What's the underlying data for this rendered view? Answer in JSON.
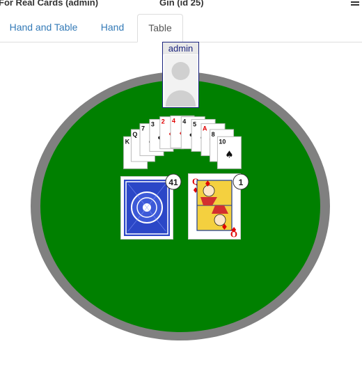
{
  "header": {
    "app_title": "For Real Cards (admin)",
    "game_title": "Gin (id 25)"
  },
  "tabs": [
    {
      "label": "Hand and Table"
    },
    {
      "label": "Hand"
    },
    {
      "label": "Table"
    }
  ],
  "active_tab": "Table",
  "player": {
    "name": "admin"
  },
  "table": {
    "felt_color": "#008000",
    "rail_color": "#808080",
    "deck_count": "41",
    "discard_count": "1",
    "discard_top": {
      "rank": "Q",
      "suit": "diamonds",
      "color": "#e00000"
    }
  },
  "opponent_hand_fan": [
    {
      "rank": "K",
      "suit": "spades"
    },
    {
      "rank": "Q",
      "suit": "clubs"
    },
    {
      "rank": "7",
      "suit": "spades"
    },
    {
      "rank": "3",
      "suit": "clubs"
    },
    {
      "rank": "2",
      "suit": "diamonds"
    },
    {
      "rank": "4",
      "suit": "diamonds"
    },
    {
      "rank": "4",
      "suit": "clubs"
    },
    {
      "rank": "5",
      "suit": "spades"
    },
    {
      "rank": "A",
      "suit": "hearts"
    },
    {
      "rank": "8",
      "suit": "spades"
    },
    {
      "rank": "10",
      "suit": "spades"
    }
  ]
}
